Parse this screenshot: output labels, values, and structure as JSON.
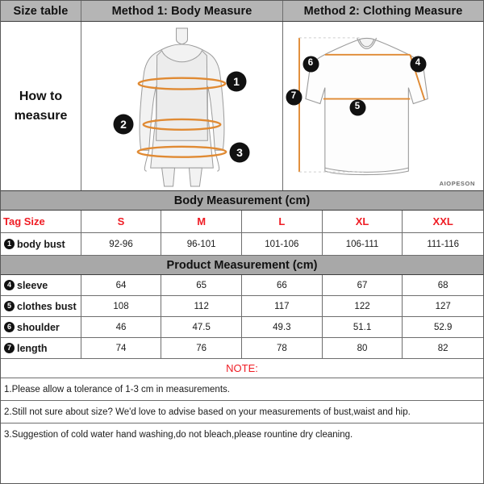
{
  "header": {
    "col1": "Size table",
    "col2": "Method 1: Body  Measure",
    "col3": "Method 2: Clothing Measure"
  },
  "illustration": {
    "how_to_measure": "How to\nmeasure",
    "watermark": "AIOPESON",
    "body_markers": [
      {
        "n": "1",
        "meaning": "body bust"
      },
      {
        "n": "2",
        "meaning": "waist"
      },
      {
        "n": "3",
        "meaning": "hip"
      }
    ],
    "clothing_markers": [
      {
        "n": "4",
        "meaning": "sleeve"
      },
      {
        "n": "5",
        "meaning": "clothes bust"
      },
      {
        "n": "6",
        "meaning": "shoulder"
      },
      {
        "n": "7",
        "meaning": "length"
      }
    ]
  },
  "body_section": {
    "title": "Body Measurement (cm)",
    "size_header_label": "Tag Size",
    "sizes": [
      "S",
      "M",
      "L",
      "XL",
      "XXL"
    ],
    "rows": [
      {
        "num": "1",
        "label": "body bust",
        "values": [
          "92-96",
          "96-101",
          "101-106",
          "106-111",
          "111-116"
        ]
      }
    ]
  },
  "product_section": {
    "title": "Product Measurement (cm)",
    "rows": [
      {
        "num": "4",
        "label": "sleeve",
        "values": [
          "64",
          "65",
          "66",
          "67",
          "68"
        ]
      },
      {
        "num": "5",
        "label": "clothes bust",
        "values": [
          "108",
          "112",
          "117",
          "122",
          "127"
        ]
      },
      {
        "num": "6",
        "label": "shoulder",
        "values": [
          "46",
          "47.5",
          "49.3",
          "51.1",
          "52.9"
        ]
      },
      {
        "num": "7",
        "label": "length",
        "values": [
          "74",
          "76",
          "78",
          "80",
          "82"
        ]
      }
    ]
  },
  "notes": {
    "title": "NOTE:",
    "items": [
      "1.Please allow a tolerance of 1-3 cm in measurements.",
      "2.Still not sure about size? We'd love to advise based on your measurements of bust,waist and hip.",
      "3.Suggestion of cold water hand washing,do not bleach,please rountine dry cleaning."
    ]
  },
  "colors": {
    "accent_red": "#ef1c24",
    "band_gray": "#a8a8a8",
    "header_gray": "#b5b5b5",
    "measure_orange": "#e08a33",
    "figure_line": "#9b9b9b"
  }
}
